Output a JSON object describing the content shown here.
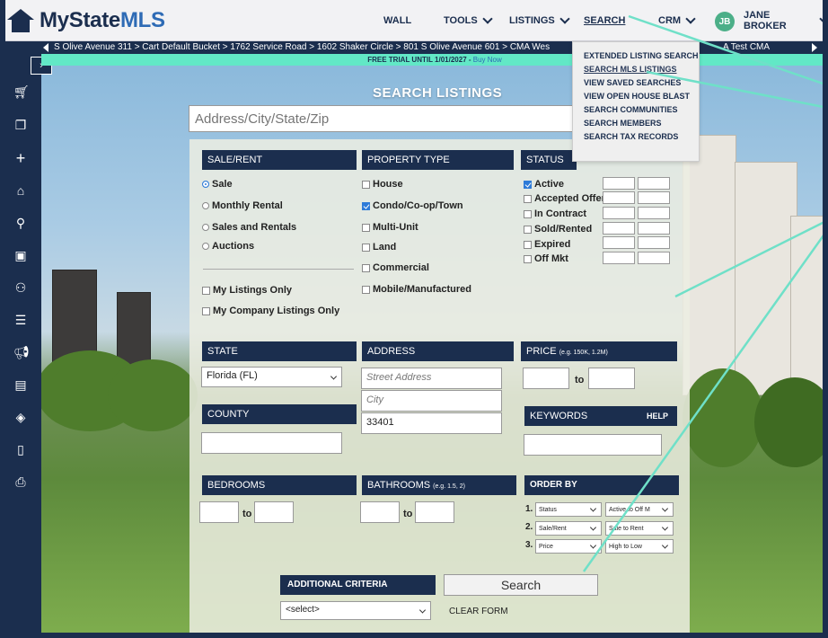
{
  "brand": {
    "name_part1": "MyState",
    "name_part2": "MLS"
  },
  "nav": {
    "wall": "WALL",
    "tools": "TOOLS",
    "listings": "LISTINGS",
    "search": "SEARCH",
    "crm": "CRM",
    "user_initials": "JB",
    "user_name": "JANE BROKER"
  },
  "breadcrumbs": "S Olive Avenue 311 > Cart Default Bucket > 1762 Service Road > 1602 Shaker Circle > 801 S Olive Avenue 601 > CMA Wes",
  "breadcrumbs_tail": "A Test CMA",
  "trial": {
    "text": "FREE TRIAL UNTIL 1/01/2027 - ",
    "buy": "Buy Now"
  },
  "search_menu": {
    "items": [
      "EXTENDED LISTING SEARCH",
      "SEARCH MLS LISTINGS",
      "VIEW SAVED SEARCHES",
      "VIEW OPEN HOUSE BLAST",
      "SEARCH COMMUNITIES",
      "SEARCH MEMBERS",
      "SEARCH TAX RECORDS"
    ]
  },
  "page_title": "SEARCH LISTINGS",
  "address_search": {
    "placeholder": "Address/City/State/Zip"
  },
  "sale_rent": {
    "header": "SALE/RENT",
    "options": [
      "Sale",
      "Monthly Rental",
      "Sales and Rentals",
      "Auctions"
    ],
    "selected": "Sale",
    "my_listings": "My Listings Only",
    "my_company": "My Company Listings Only"
  },
  "property_type": {
    "header": "PROPERTY TYPE",
    "options": [
      "House",
      "Condo/Co-op/Town",
      "Multi-Unit",
      "Land",
      "Commercial",
      "Mobile/Manufactured"
    ],
    "checked": [
      "Condo/Co-op/Town"
    ]
  },
  "status": {
    "header": "STATUS",
    "options": [
      "Active",
      "Accepted Offer",
      "In Contract",
      "Sold/Rented",
      "Expired",
      "Off Mkt"
    ],
    "checked": [
      "Active"
    ]
  },
  "state": {
    "header": "STATE",
    "value": "Florida (FL)"
  },
  "address": {
    "header": "ADDRESS",
    "street_placeholder": "Street Address",
    "city_placeholder": "City",
    "zip_value": "33401"
  },
  "price": {
    "header": "PRICE",
    "hint": "(e.g. 150K, 1.2M)",
    "to": "to"
  },
  "county": {
    "header": "COUNTY"
  },
  "keywords": {
    "header": "KEYWORDS",
    "help": "HELP"
  },
  "bedrooms": {
    "header": "BEDROOMS",
    "to": "to"
  },
  "bathrooms": {
    "header": "BATHROOMS",
    "hint": "(e.g. 1.5, 2)",
    "to": "to"
  },
  "order_by": {
    "header": "ORDER BY",
    "rows": [
      {
        "num": "1.",
        "field": "Status",
        "order": "Active to Off M"
      },
      {
        "num": "2.",
        "field": "Sale/Rent",
        "order": "Sale to Rent"
      },
      {
        "num": "3.",
        "field": "Price",
        "order": "High to Low"
      }
    ]
  },
  "additional_criteria": {
    "header": "ADDITIONAL CRITERIA",
    "value": "<select>"
  },
  "search_button": "Search",
  "clear_form": "CLEAR FORM",
  "colors": {
    "navy": "#1b2e4e",
    "accent": "#62e8c6",
    "checkbox": "#2e7bd8"
  }
}
